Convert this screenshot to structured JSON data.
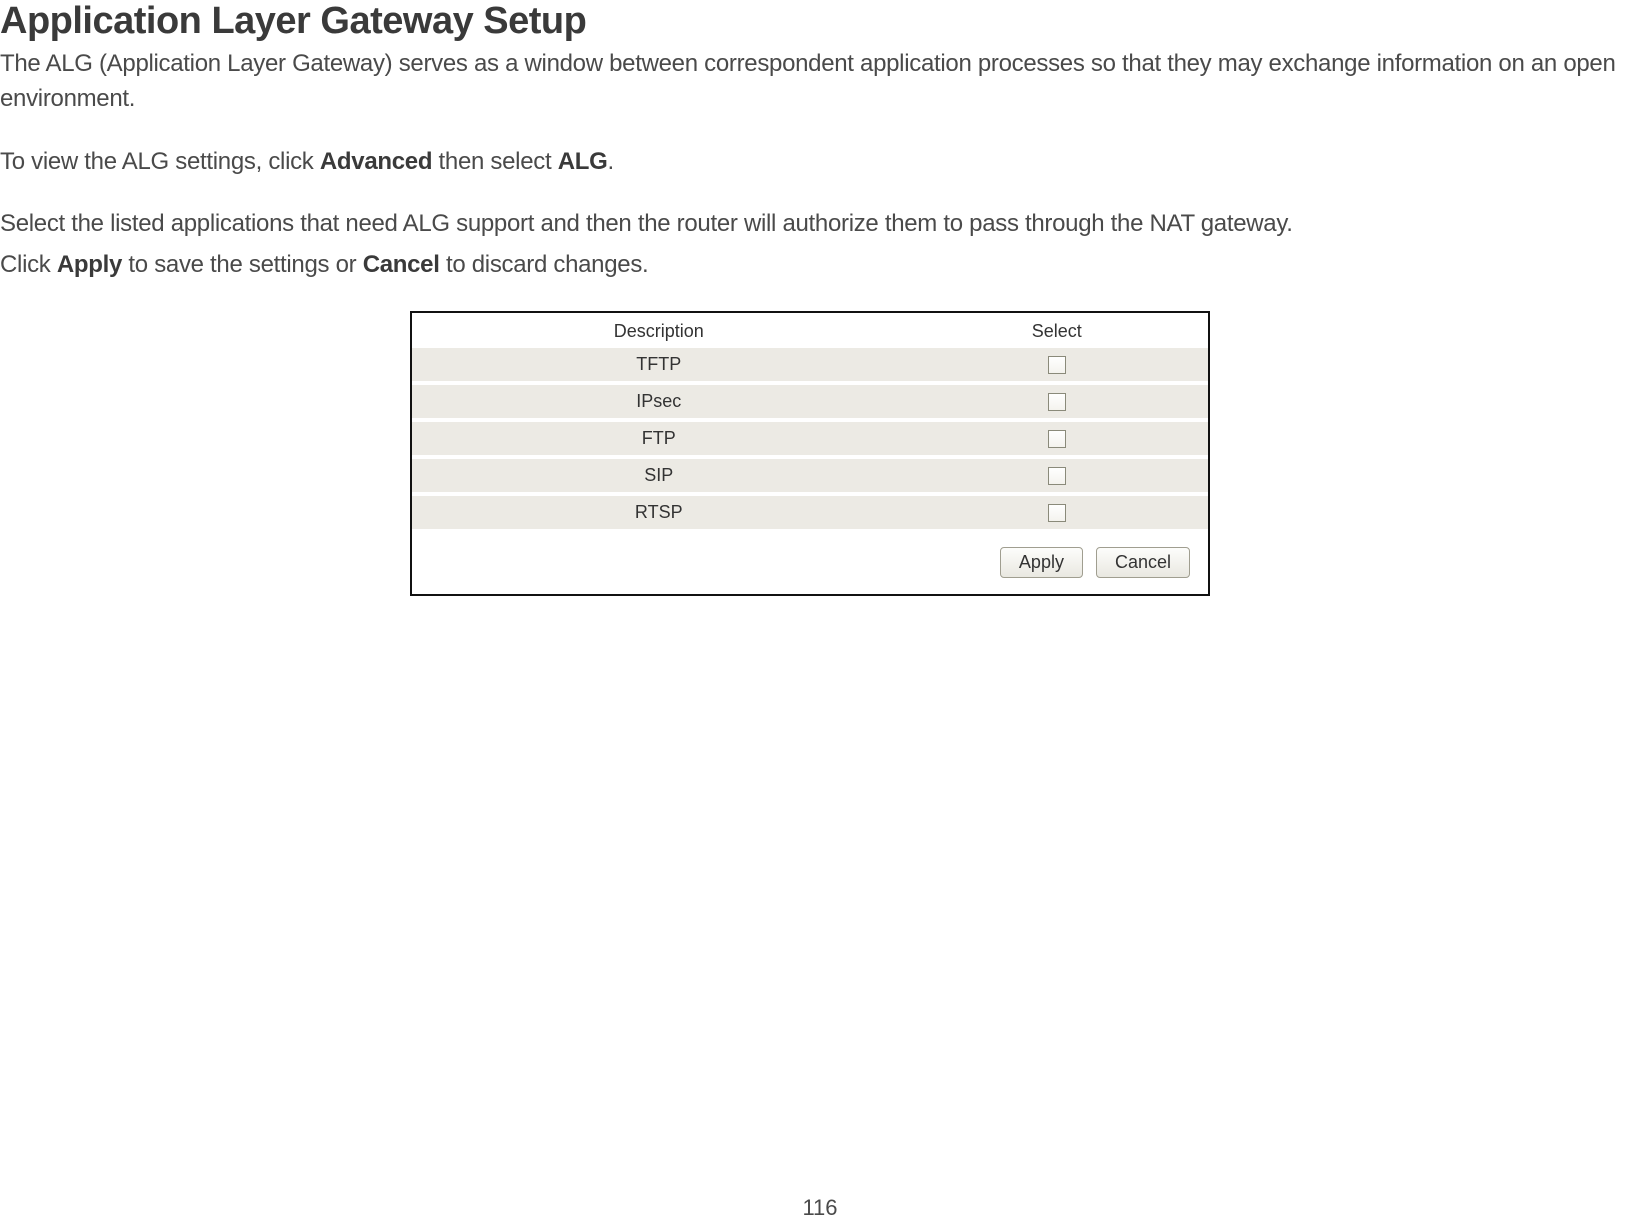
{
  "page": {
    "title": "Application Layer Gateway Setup",
    "intro": "The ALG (Application Layer Gateway) serves as a window between correspondent application processes so that they may exchange information on an open environment.",
    "nav_instruction_prefix": "To view the ALG settings, click ",
    "nav_step1": "Advanced",
    "nav_mid": " then select ",
    "nav_step2": "ALG",
    "nav_suffix": ".",
    "select_instruction": "Select the listed applications that need ALG support and then the router will authorize them to pass through the NAT gateway.",
    "click_prefix": "Click ",
    "apply_word": "Apply",
    "click_mid": " to save the settings or ",
    "cancel_word": "Cancel",
    "click_suffix": " to discard changes.",
    "page_number": "116"
  },
  "table": {
    "header_description": "Description",
    "header_select": "Select",
    "rows": [
      {
        "label": "TFTP",
        "checked": false
      },
      {
        "label": "IPsec",
        "checked": false
      },
      {
        "label": "FTP",
        "checked": false
      },
      {
        "label": "SIP",
        "checked": false
      },
      {
        "label": "RTSP",
        "checked": false
      }
    ]
  },
  "buttons": {
    "apply": "Apply",
    "cancel": "Cancel"
  }
}
